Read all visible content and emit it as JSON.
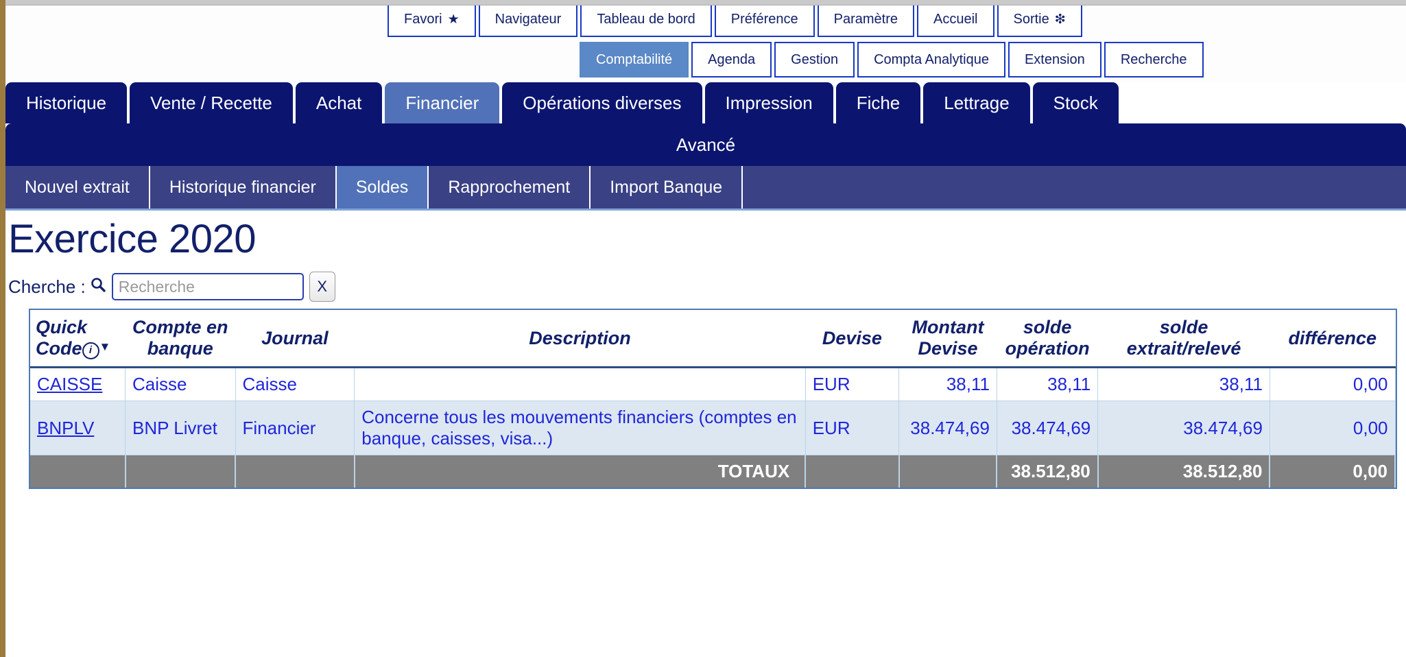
{
  "topmenu": {
    "row1": [
      {
        "label": "Favori",
        "glyph": "★",
        "selected": false
      },
      {
        "label": "Navigateur",
        "glyph": "",
        "selected": false
      },
      {
        "label": "Tableau de bord",
        "glyph": "",
        "selected": false
      },
      {
        "label": "Préférence",
        "glyph": "",
        "selected": false
      },
      {
        "label": "Paramètre",
        "glyph": "",
        "selected": false
      },
      {
        "label": "Accueil",
        "glyph": "",
        "selected": false
      },
      {
        "label": "Sortie",
        "glyph": "❇",
        "selected": false
      }
    ],
    "row2": [
      {
        "label": "Comptabilité",
        "glyph": "",
        "selected": true
      },
      {
        "label": "Agenda",
        "glyph": "",
        "selected": false
      },
      {
        "label": "Gestion",
        "glyph": "",
        "selected": false
      },
      {
        "label": "Compta Analytique",
        "glyph": "",
        "selected": false
      },
      {
        "label": "Extension",
        "glyph": "",
        "selected": false
      },
      {
        "label": "Recherche",
        "glyph": "",
        "selected": false
      }
    ]
  },
  "mainnav": [
    {
      "label": "Historique",
      "selected": false
    },
    {
      "label": "Vente / Recette",
      "selected": false
    },
    {
      "label": "Achat",
      "selected": false
    },
    {
      "label": "Financier",
      "selected": true
    },
    {
      "label": "Opérations diverses",
      "selected": false
    },
    {
      "label": "Impression",
      "selected": false
    },
    {
      "label": "Fiche",
      "selected": false
    },
    {
      "label": "Lettrage",
      "selected": false
    },
    {
      "label": "Stock",
      "selected": false
    }
  ],
  "avance": {
    "label": "Avancé"
  },
  "subnav": [
    {
      "label": "Nouvel extrait",
      "selected": false
    },
    {
      "label": "Historique financier",
      "selected": false
    },
    {
      "label": "Soldes",
      "selected": true
    },
    {
      "label": "Rapprochement",
      "selected": false
    },
    {
      "label": "Import Banque",
      "selected": false
    }
  ],
  "page": {
    "title": "Exercice 2020"
  },
  "search": {
    "label": "Cherche :",
    "magnifier": "🔍",
    "placeholder": "Recherche",
    "value": "",
    "clear_label": "X"
  },
  "table": {
    "headers": {
      "quick_code": "Quick Code",
      "compte_en_banque": "Compte en banque",
      "journal": "Journal",
      "description": "Description",
      "devise": "Devise",
      "montant_devise": "Montant Devise",
      "solde_operation": "solde opération",
      "solde_extrait": "solde extrait/relevé",
      "difference": "différence"
    },
    "rows": [
      {
        "quick_code": "CAISSE",
        "compte": "Caisse",
        "journal": "Caisse",
        "description": "",
        "devise": "EUR",
        "montant_devise": "38,11",
        "solde_operation": "38,11",
        "solde_extrait": "38,11",
        "difference": "0,00",
        "alt": false
      },
      {
        "quick_code": "BNPLV",
        "compte": "BNP Livret",
        "journal": "Financier",
        "description": "Concerne tous les mouvements financiers (comptes en banque, caisses, visa...)",
        "devise": "EUR",
        "montant_devise": "38.474,69",
        "solde_operation": "38.474,69",
        "solde_extrait": "38.474,69",
        "difference": "0,00",
        "alt": true
      }
    ],
    "totaux": {
      "label": "TOTAUX",
      "solde_operation": "38.512,80",
      "solde_extrait": "38.512,80",
      "difference": "0,00"
    }
  },
  "colors": {
    "navy": "#0b1570",
    "navy_selected": "#5172b8",
    "subnav": "#3a4185",
    "accent_blue": "#1939c4",
    "link": "#2026d8",
    "alt_row": "#dce7f2",
    "totaux_bg": "#808080"
  }
}
